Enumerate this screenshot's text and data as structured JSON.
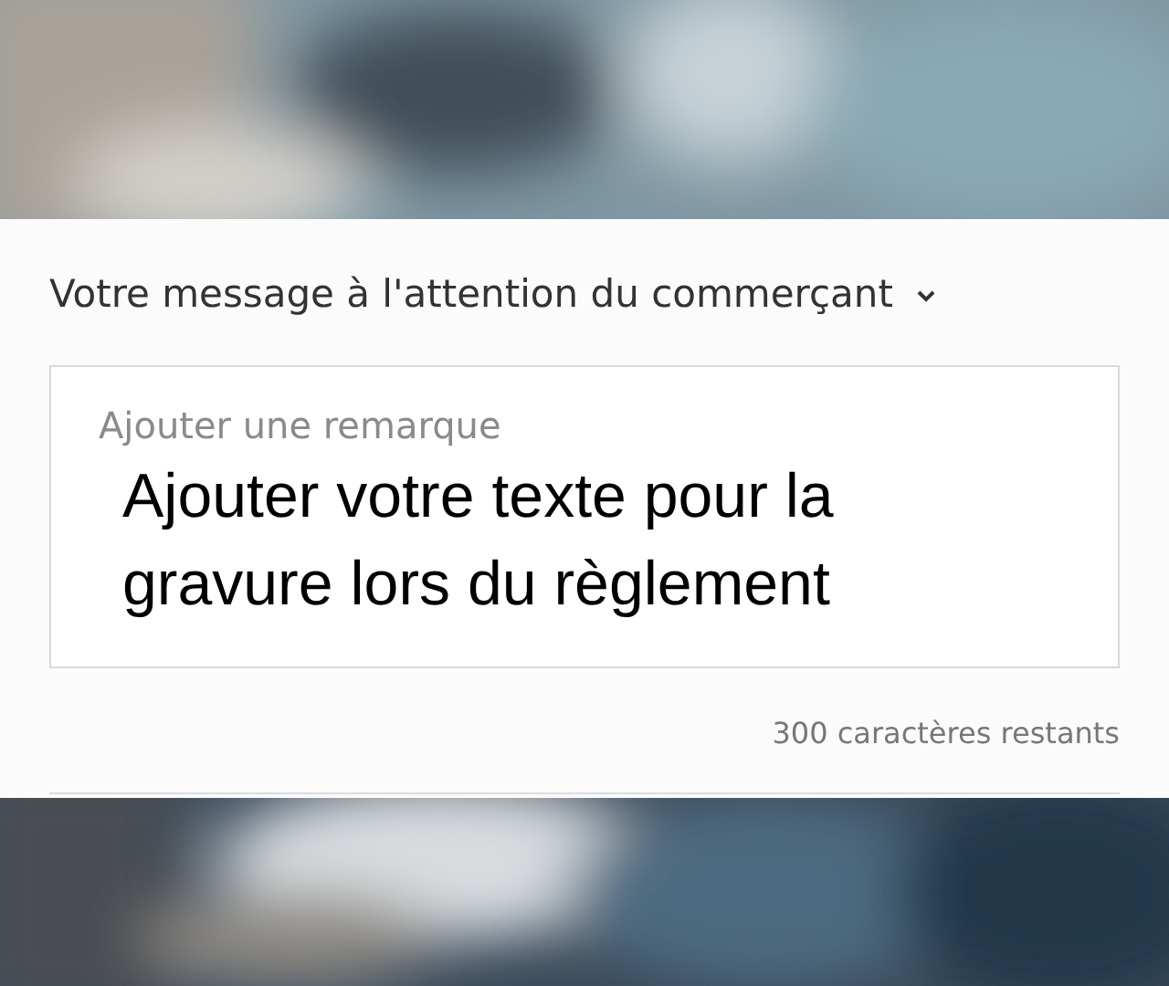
{
  "form": {
    "heading": "Votre message à l'attention du commerçant",
    "expanded": true,
    "remark": {
      "placeholder": "Ajouter une remarque"
    },
    "overlay_text": "Ajouter votre texte pour la gravure lors du règlement",
    "counter": "300 caractères restants"
  }
}
